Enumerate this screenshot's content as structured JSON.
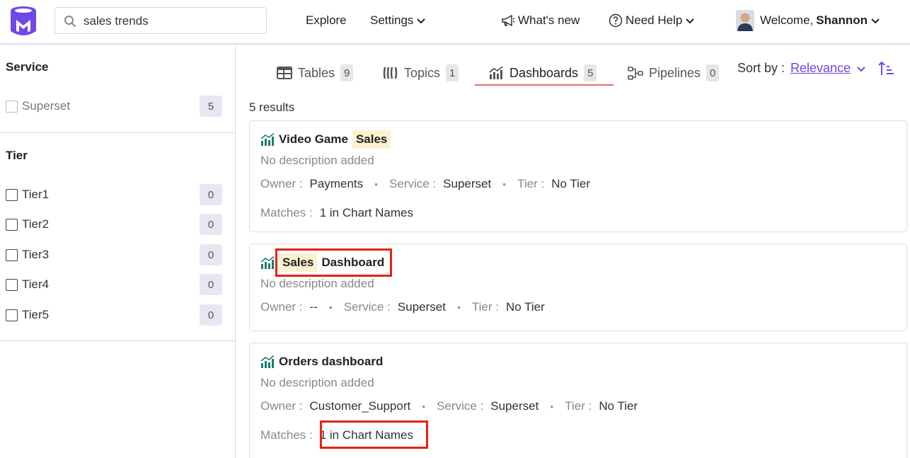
{
  "header": {
    "search": {
      "value": "sales trends"
    },
    "nav": {
      "explore": "Explore",
      "settings": "Settings",
      "whats_new": "What's new",
      "need_help": "Need Help",
      "welcome_prefix": "Welcome,",
      "user_name": "Shannon"
    },
    "brand_color": "#7147e8"
  },
  "sidebar": {
    "service_title": "Service",
    "service_items": [
      {
        "label": "Superset",
        "count": "5"
      }
    ],
    "tier_title": "Tier",
    "tier_items": [
      {
        "label": "Tier1",
        "count": "0"
      },
      {
        "label": "Tier2",
        "count": "0"
      },
      {
        "label": "Tier3",
        "count": "0"
      },
      {
        "label": "Tier4",
        "count": "0"
      },
      {
        "label": "Tier5",
        "count": "0"
      }
    ]
  },
  "tabs": [
    {
      "label": "Tables",
      "count": "9",
      "icon": "table-icon"
    },
    {
      "label": "Topics",
      "count": "1",
      "icon": "topic-icon"
    },
    {
      "label": "Dashboards",
      "count": "5",
      "icon": "dashboard-icon",
      "active": true
    },
    {
      "label": "Pipelines",
      "count": "0",
      "icon": "pipeline-icon"
    }
  ],
  "sort": {
    "label": "Sort by :",
    "value": "Relevance"
  },
  "results": {
    "count_text": "5 results",
    "items": [
      {
        "title_parts": [
          "Video Game",
          "Sales"
        ],
        "description": "No description added",
        "owner_label": "Owner :",
        "owner": "Payments",
        "service_label": "Service :",
        "service": "Superset",
        "tier_label": "Tier :",
        "tier": "No Tier",
        "matches_label": "Matches :",
        "matches": "1 in Chart Names"
      },
      {
        "title_parts": [
          "Sales",
          "Dashboard"
        ],
        "description": "No description added",
        "owner_label": "Owner :",
        "owner": "--",
        "service_label": "Service :",
        "service": "Superset",
        "tier_label": "Tier :",
        "tier": "No Tier"
      },
      {
        "title_parts": [
          "Orders dashboard"
        ],
        "description": "No description added",
        "owner_label": "Owner :",
        "owner": "Customer_Support",
        "service_label": "Service :",
        "service": "Superset",
        "tier_label": "Tier :",
        "tier": "No Tier",
        "matches_label": "Matches :",
        "matches": "1 in Chart Names"
      }
    ]
  }
}
